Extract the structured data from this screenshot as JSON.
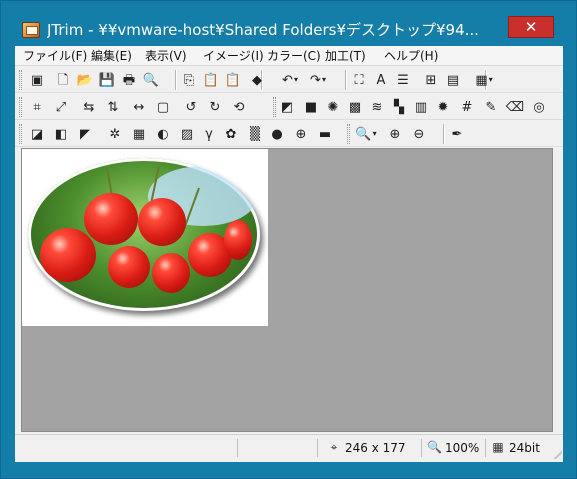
{
  "window": {
    "title": "JTrim - ¥¥vmware-host¥Shared Folders¥デスクトップ¥94...",
    "close_label": "✕"
  },
  "menu": [
    "ファイル(F)",
    "編集(E)",
    "表示(V)",
    "イメージ(I)",
    "カラー(C)",
    "加工(T)",
    "ヘルプ(H)"
  ],
  "toolbar1": [
    {
      "name": "new-window-icon",
      "glyph": "▣"
    },
    {
      "name": "new-file-icon",
      "glyph": "🗋"
    },
    {
      "name": "open-icon",
      "glyph": "📂"
    },
    {
      "name": "save-icon",
      "glyph": "💾"
    },
    {
      "name": "print-icon",
      "glyph": "🖶"
    },
    {
      "name": "print-preview-icon",
      "glyph": "🔍"
    },
    {
      "name": "copy-icon",
      "glyph": "⎘"
    },
    {
      "name": "paste-icon",
      "glyph": "📋"
    },
    {
      "name": "paste-new-icon",
      "glyph": "📋"
    },
    {
      "name": "capture-icon",
      "glyph": "◆"
    },
    {
      "name": "undo-icon",
      "glyph": "↶"
    },
    {
      "name": "redo-icon",
      "glyph": "↷"
    },
    {
      "name": "fit-window-icon",
      "glyph": "⛶"
    },
    {
      "name": "text-icon",
      "glyph": "A"
    },
    {
      "name": "lines-icon",
      "glyph": "☰"
    },
    {
      "name": "grid-icon",
      "glyph": "⊞"
    },
    {
      "name": "filmstrip-icon",
      "glyph": "▤"
    },
    {
      "name": "color-palette-icon",
      "glyph": "▦"
    }
  ],
  "toolbar2": [
    {
      "name": "crop-icon",
      "glyph": "⌗"
    },
    {
      "name": "resize-icon",
      "glyph": "⤢"
    },
    {
      "name": "flip-horizontal-icon",
      "glyph": "⇆"
    },
    {
      "name": "flip-vertical-icon",
      "glyph": "⇅"
    },
    {
      "name": "mirror-icon",
      "glyph": "↔"
    },
    {
      "name": "frame-icon",
      "glyph": "▢"
    },
    {
      "name": "rotate-left-90-icon",
      "glyph": "↺"
    },
    {
      "name": "rotate-right-90-icon",
      "glyph": "↻"
    },
    {
      "name": "rotate-free-icon",
      "glyph": "⟲"
    },
    {
      "name": "shadow-icon",
      "glyph": "◩"
    },
    {
      "name": "gray-box-icon",
      "glyph": "■"
    },
    {
      "name": "sunburst-icon",
      "glyph": "✺"
    },
    {
      "name": "mosaic-icon",
      "glyph": "▩"
    },
    {
      "name": "wave-icon",
      "glyph": "≋"
    },
    {
      "name": "dither-icon",
      "glyph": "▚"
    },
    {
      "name": "brick-icon",
      "glyph": "▥"
    },
    {
      "name": "spark-icon",
      "glyph": "✹"
    },
    {
      "name": "fence-icon",
      "glyph": "#"
    },
    {
      "name": "pen-icon",
      "glyph": "✎"
    },
    {
      "name": "eraser-icon",
      "glyph": "⌫"
    },
    {
      "name": "spiral-icon",
      "glyph": "◎"
    }
  ],
  "toolbar3": [
    {
      "name": "bevel-icon",
      "glyph": "◪"
    },
    {
      "name": "sepia-icon",
      "glyph": "◧"
    },
    {
      "name": "blue-tone-icon",
      "glyph": "◤"
    },
    {
      "name": "sparkle-icon",
      "glyph": "✲"
    },
    {
      "name": "rgb-bars-icon",
      "glyph": "▦"
    },
    {
      "name": "contrast-icon",
      "glyph": "◐"
    },
    {
      "name": "picture-icon",
      "glyph": "▨"
    },
    {
      "name": "gamma-icon",
      "glyph": "γ"
    },
    {
      "name": "color-wheel-icon",
      "glyph": "✿"
    },
    {
      "name": "checker-icon",
      "glyph": "▒"
    },
    {
      "name": "rgb-circles-icon",
      "glyph": "●"
    },
    {
      "name": "xor-icon",
      "glyph": "⊕"
    },
    {
      "name": "gradient-icon",
      "glyph": "▬"
    },
    {
      "name": "zoom-icon",
      "glyph": "🔍"
    },
    {
      "name": "zoom-in-icon",
      "glyph": "⊕"
    },
    {
      "name": "zoom-out-icon",
      "glyph": "⊖"
    },
    {
      "name": "eyedropper-icon",
      "glyph": "✒"
    }
  ],
  "status": {
    "dimensions": "246 x 177",
    "zoom": "100%",
    "bit_depth": "24bit"
  },
  "colors": {
    "desktop": "#1a86b4",
    "close_button": "#c9302c",
    "canvas_background": "#a3a3a3"
  }
}
